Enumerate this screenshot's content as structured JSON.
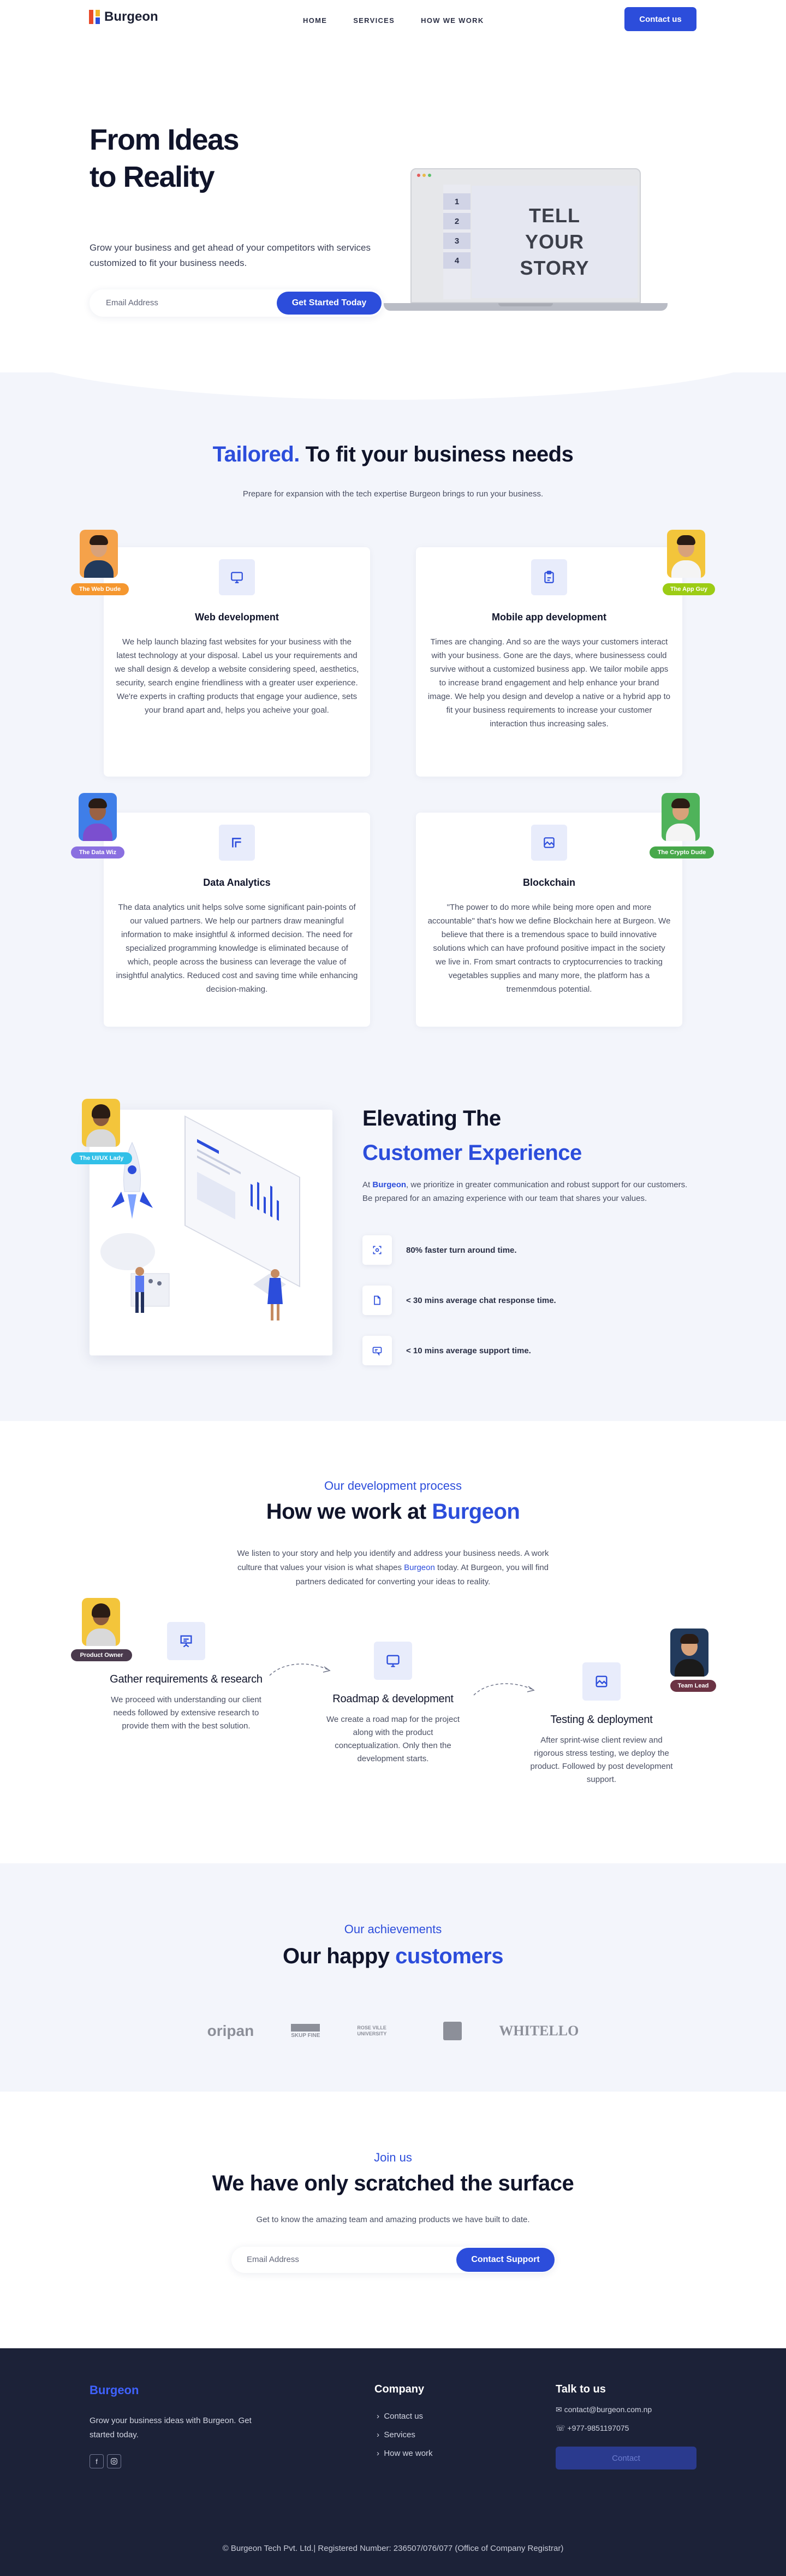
{
  "brand": "Burgeon",
  "nav": {
    "items": [
      "HOME",
      "SERVICES",
      "HOW WE WORK"
    ],
    "contact_label": "Contact us"
  },
  "hero": {
    "title_line1": "From Ideas",
    "title_line2": "to Reality",
    "subtitle": "Grow your business and get ahead of your competitors with services customized to fit your business needs.",
    "email_placeholder": "Email Address",
    "cta": "Get Started Today",
    "screen_tabs": [
      "1",
      "2",
      "3",
      "4"
    ],
    "story_lines": [
      "TELL",
      "YOUR",
      "STORY"
    ]
  },
  "services": {
    "title_accent": "Tailored.",
    "title_rest": "To fit your business needs",
    "subtitle": "Prepare for expansion with the tech expertise Burgeon brings to run your business.",
    "cards": [
      {
        "title": "Web development",
        "text": "We help launch blazing fast websites for your business with the latest technology at your disposal. Label us your requirements and we shall design & develop a website considering speed, aesthetics, security, search engine friendliness with a greater user experience. We're experts in crafting products that engage your audience, sets your brand apart and, helps you acheive your goal.",
        "icon": "monitor-icon",
        "person_tag": "The Web Dude",
        "tag_color": "#f5972f"
      },
      {
        "title": "Mobile app development",
        "text": "Times are changing. And so are the ways your customers interact with your business. Gone are the days, where businessess could survive without a customized business app. We tailor mobile apps to increase brand engagement and help enhance your brand image. We help you design and develop a native or a hybrid app to fit your business requirements to increase your customer interaction thus increasing sales.",
        "icon": "clipboard-icon",
        "person_tag": "The App Guy",
        "tag_color": "#9ccc15"
      },
      {
        "title": "Data Analytics",
        "text": "The data analytics unit helps solve some significant pain-points of our valued partners. We help our partners draw meaningful information to make insightful & informed decision. The need for specialized programming knowledge is eliminated because of which, people across the business can leverage the value of insightful analytics. Reduced cost and saving time while enhancing decision-making.",
        "icon": "chart-icon",
        "person_tag": "The Data Wiz",
        "tag_color": "#8a6fe0"
      },
      {
        "title": "Blockchain",
        "text": "\"The power to do more while being more open and more accountable\" that's how we define Blockchain here at Burgeon. We believe that there is a tremendous space to build innovative solutions which can have profound positive impact in the society we live in. From smart contracts to cryptocurrencies to tracking vegetables supplies and many more, the platform has a tremenmdous potential.",
        "icon": "image-icon",
        "person_tag": "The Crypto Dude",
        "tag_color": "#47a84a"
      }
    ]
  },
  "elevate": {
    "title_line1": "Elevating The",
    "title_line2": "Customer Experience",
    "desc_prefix": "At",
    "desc_brand": "Burgeon",
    "desc_rest": ", we prioritize in greater communication and robust support for our customers. Be prepared for an amazing experience with our team that shares your values.",
    "person_tag": "The UI/UX Lady",
    "stats": [
      {
        "text": "80% faster turn around time.",
        "icon": "focus-icon"
      },
      {
        "text": "< 30 mins average chat response time.",
        "icon": "file-icon"
      },
      {
        "text": "< 10 mins average support time.",
        "icon": "support-icon"
      }
    ]
  },
  "process": {
    "kicker": "Our development process",
    "title_prefix": "How we work at",
    "title_accent": "Burgeon",
    "desc_1": "We listen to your story and help you identify and address your business needs. A work culture that values your vision is what shapes",
    "desc_brand": "Burgeon",
    "desc_2": "today. At Burgeon, you will find partners dedicated for converting your ideas to reality.",
    "steps": [
      {
        "title": "Gather requirements & research",
        "text": "We proceed with understanding our client needs followed by extensive research to provide them with the best solution."
      },
      {
        "title": "Roadmap & development",
        "text": "We create a road map for the project along with the product conceptualization. Only then the development starts."
      },
      {
        "title": "Testing & deployment",
        "text": "After sprint-wise client review and rigorous stress testing, we deploy the product. Followed by post development support."
      }
    ],
    "tag_owner": "Product Owner",
    "tag_lead": "Team Lead"
  },
  "achievements": {
    "kicker": "Our achievements",
    "title_prefix": "Our happy",
    "title_accent": "customers",
    "logos": [
      "oripan",
      "SKUP FINE",
      "ROSE VILLE UNIVERSITY",
      "",
      "WHITELLO"
    ]
  },
  "join": {
    "kicker": "Join us",
    "title": "We have only scratched the surface",
    "subtitle": "Get to know the amazing team and amazing products we have built to date.",
    "email_placeholder": "Email Address",
    "cta": "Contact Support"
  },
  "footer": {
    "brand": "Burgeon",
    "desc": "Grow your business ideas with Burgeon. Get started today.",
    "company_title": "Company",
    "links": [
      "Contact us",
      "Services",
      "How we work"
    ],
    "talk_title": "Talk to us",
    "email": "contact@burgeon.com.np",
    "phone": "+977-9851197075",
    "contact_btn": "Contact",
    "copyright": "© Burgeon Tech Pvt. Ltd.| Registered Number: 236507/076/077 (Office of Company Registrar)"
  },
  "colors": {
    "accent": "#2c4ddb",
    "footer_bg": "#1c2238",
    "section_bg": "#f3f5fb"
  }
}
